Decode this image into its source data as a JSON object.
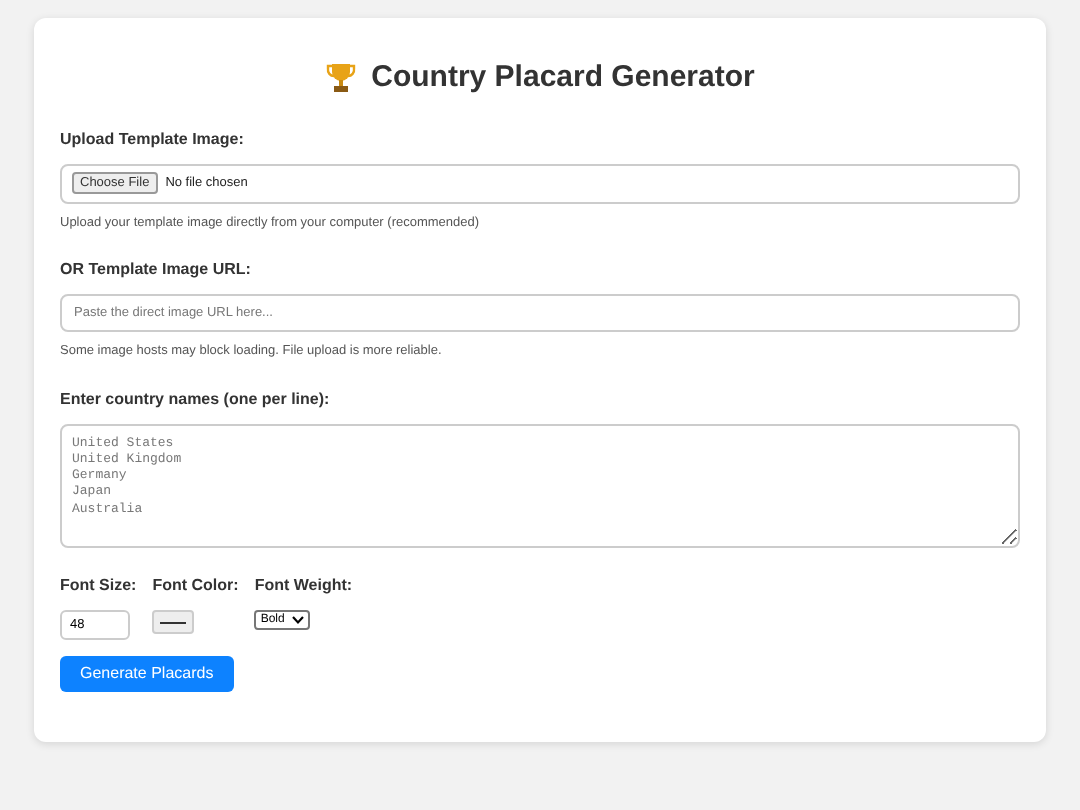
{
  "title": "Country Placard Generator",
  "upload": {
    "label": "Upload Template Image:",
    "button": "Choose File",
    "status": "No file chosen",
    "help": "Upload your template image directly from your computer (recommended)"
  },
  "url": {
    "label": "OR Template Image URL:",
    "placeholder": "Paste the direct image URL here...",
    "help": "Some image hosts may block loading. File upload is more reliable."
  },
  "countries": {
    "label": "Enter country names (one per line):",
    "placeholder": "United States\nUnited Kingdom\nGermany\nJapan\nAustralia"
  },
  "font_size": {
    "label": "Font Size:",
    "value": "48"
  },
  "font_color": {
    "label": "Font Color:",
    "color": "#333333"
  },
  "font_weight": {
    "label": "Font Weight:",
    "value": "Bold"
  },
  "button": "Generate Placards"
}
